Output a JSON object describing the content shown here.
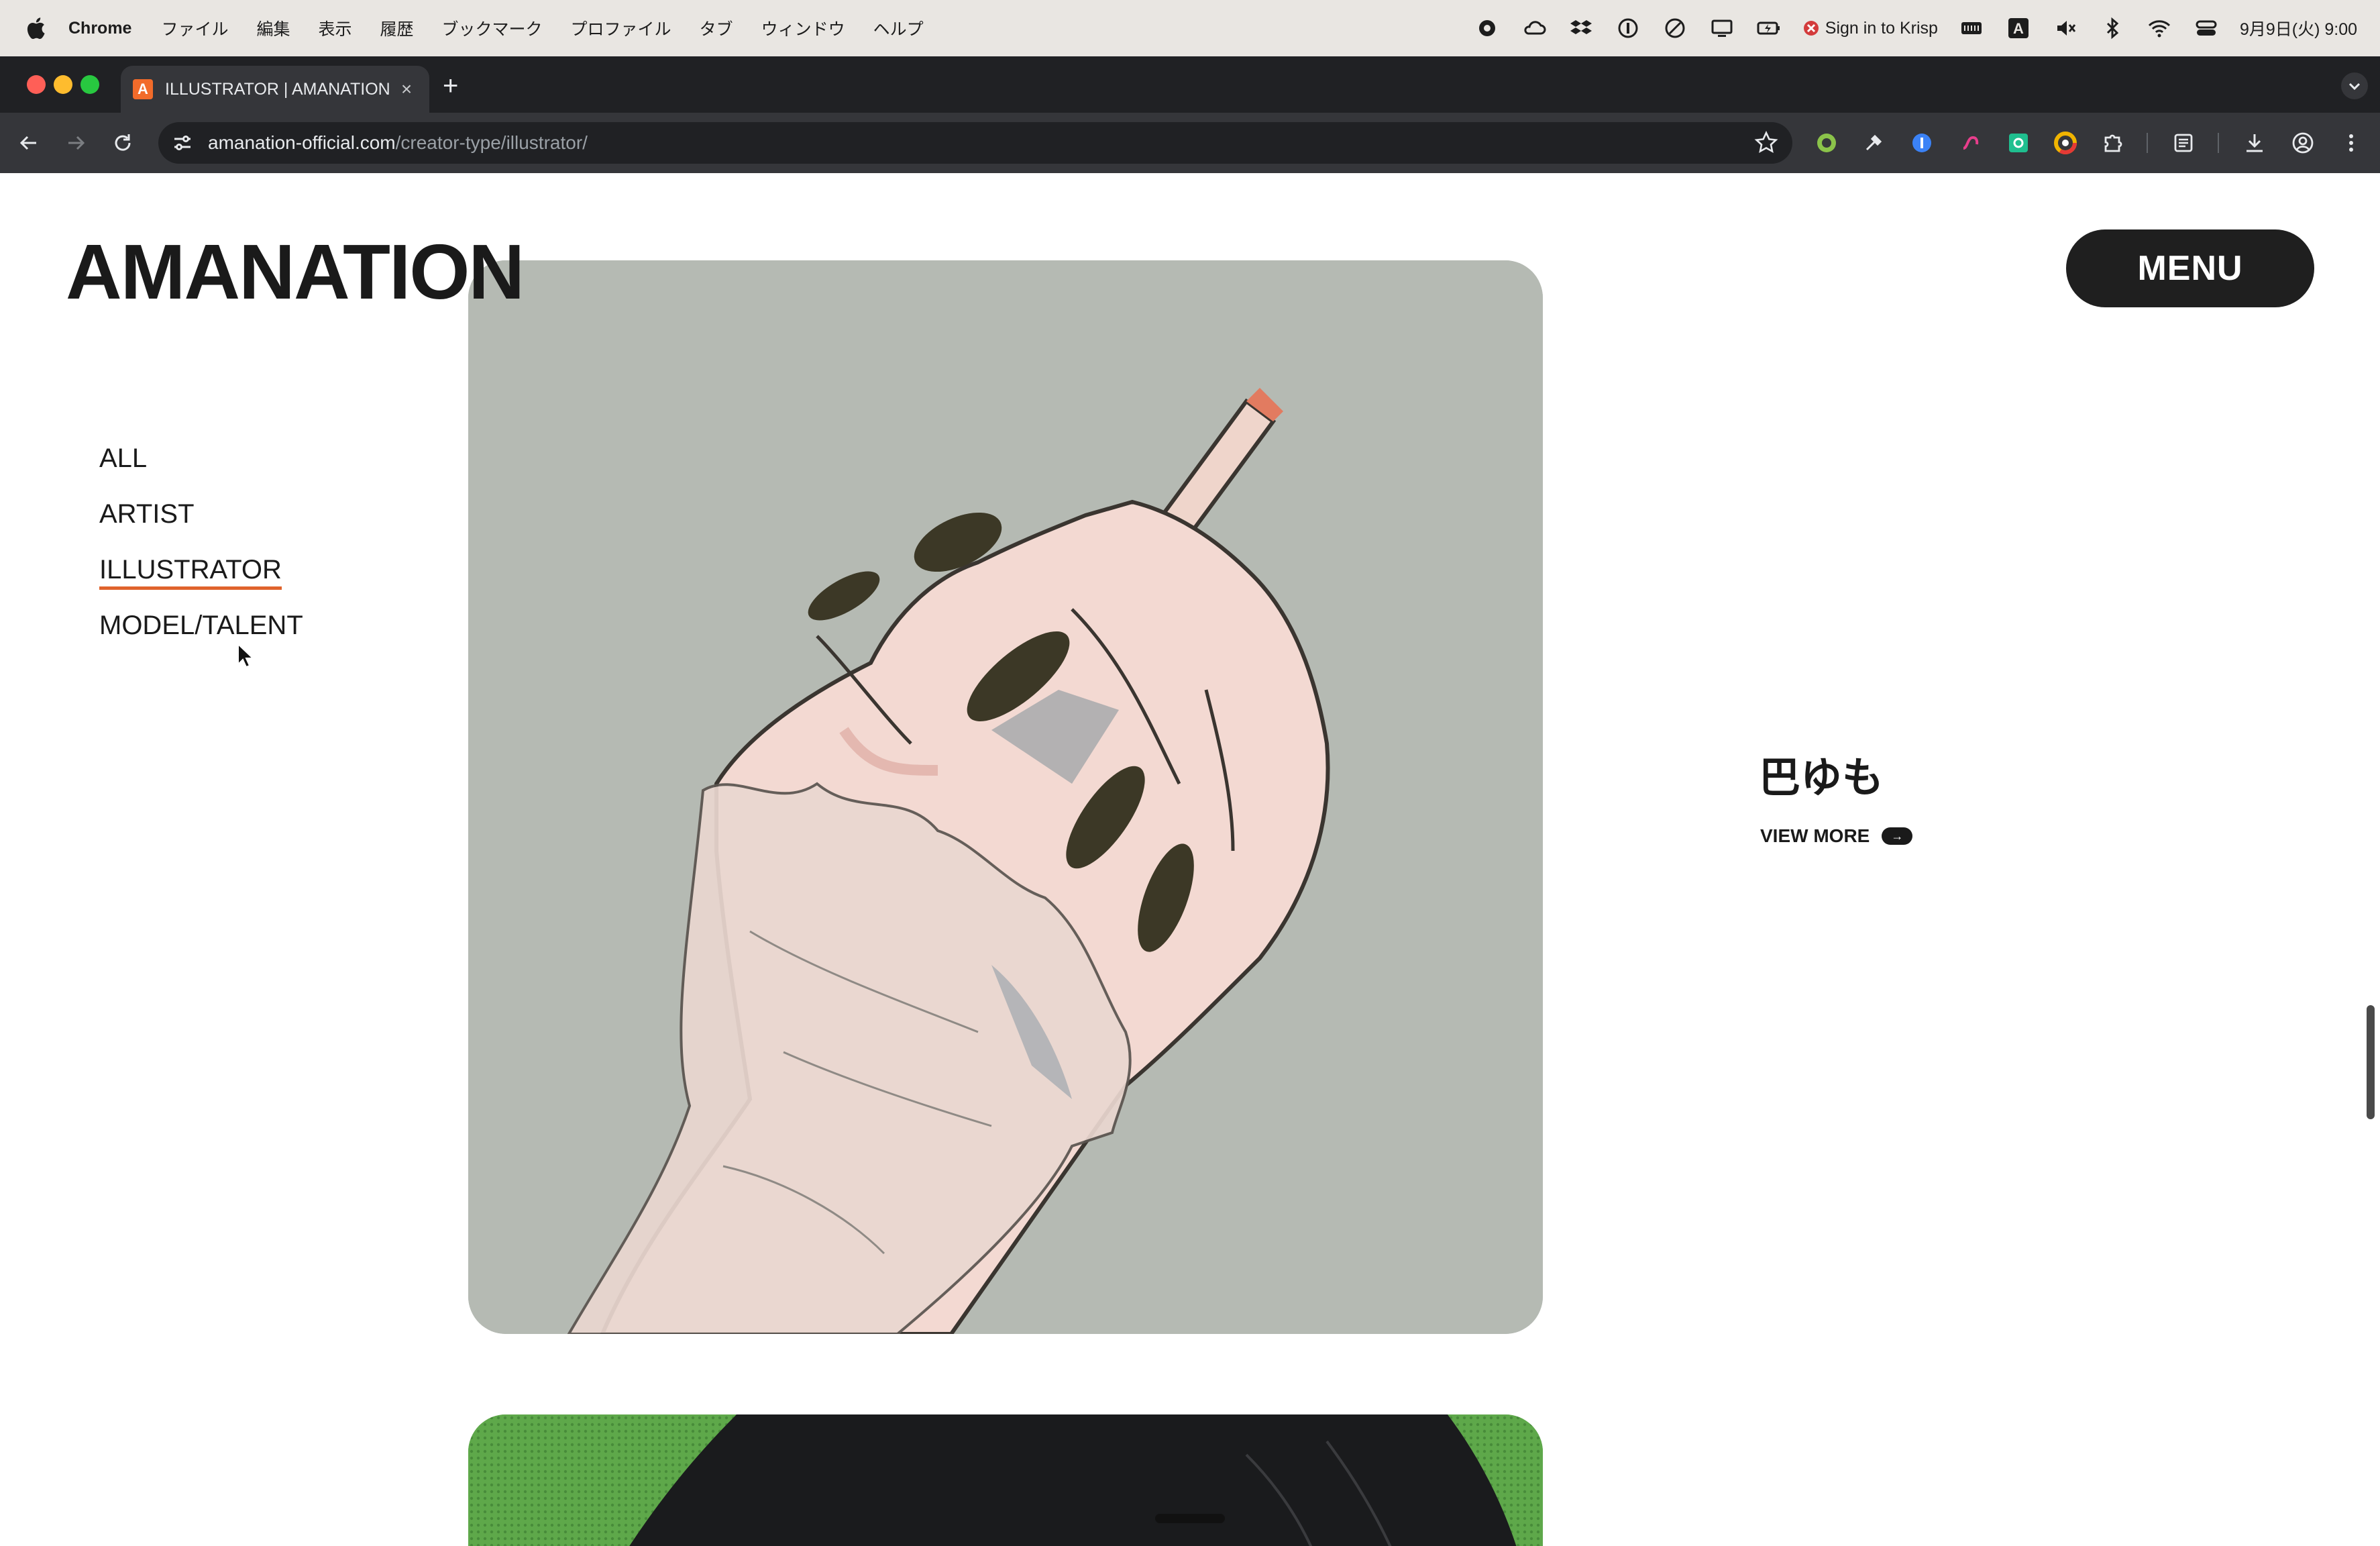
{
  "menubar": {
    "app_name": "Chrome",
    "items": [
      "ファイル",
      "編集",
      "表示",
      "履歴",
      "ブックマーク",
      "プロファイル",
      "タブ",
      "ウィンドウ",
      "ヘルプ"
    ],
    "krisp_label": "Sign in to Krisp",
    "input_indicator": "A",
    "clock": "9月9日(火) 9:00"
  },
  "browser": {
    "tab_title": "ILLUSTRATOR | AMANATION",
    "tab_favicon_letter": "A",
    "tab_close": "×",
    "new_tab": "+",
    "url_host": "amanation-official.com",
    "url_path": "/creator-type/illustrator/"
  },
  "page": {
    "logo": "AMANATION",
    "menu_label": "MENU",
    "categories": [
      {
        "label": "ALL",
        "active": false
      },
      {
        "label": "ARTIST",
        "active": false
      },
      {
        "label": "ILLUSTRATOR",
        "active": true
      },
      {
        "label": "MODEL/TALENT",
        "active": false
      }
    ],
    "creator_name": "巴ゆも",
    "view_more_label": "VIEW MORE",
    "view_more_arrow": "→"
  },
  "colors": {
    "accent_underline": "#e0632c",
    "card1_bg": "#b5bab3",
    "card2_bg": "#5ea84a",
    "menu_button": "#1f1f1f"
  }
}
